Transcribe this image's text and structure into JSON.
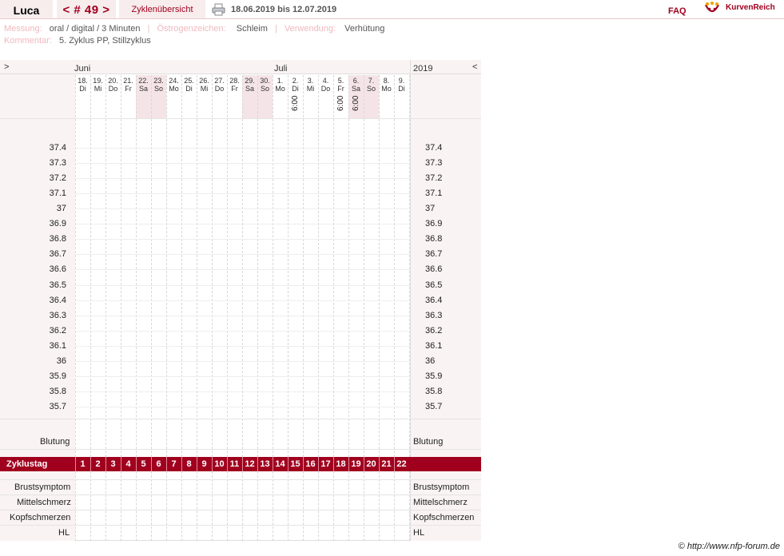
{
  "header": {
    "user_name": "Luca",
    "cycle_label": "< # 49 >",
    "overview_label": "Zyklenübersicht",
    "date_range": "18.06.2019 bis 12.07.2019",
    "faq": "FAQ",
    "logo_text": "KurvenReich"
  },
  "meta": {
    "messung_label": "Messung:",
    "messung_value": "oral / digital / 3 Minuten",
    "oestrogen_label": "Östrogenzeichen:",
    "oestrogen_value": "Schleim",
    "verwendung_label": "Verwendung:",
    "verwendung_value": "Verhütung",
    "kommentar_label": "Kommentar:",
    "kommentar_value": "5. Zyklus PP, Stillzyklus"
  },
  "nav": {
    "prev": ">",
    "next": "<",
    "month1": "Juni",
    "month2": "Juli",
    "year": "2019"
  },
  "days": [
    {
      "d": "18.",
      "w": "Di"
    },
    {
      "d": "19.",
      "w": "Mi"
    },
    {
      "d": "20.",
      "w": "Do"
    },
    {
      "d": "21.",
      "w": "Fr"
    },
    {
      "d": "22.",
      "w": "Sa"
    },
    {
      "d": "23.",
      "w": "So"
    },
    {
      "d": "24.",
      "w": "Mo"
    },
    {
      "d": "25.",
      "w": "Di"
    },
    {
      "d": "26.",
      "w": "Mi"
    },
    {
      "d": "27.",
      "w": "Do"
    },
    {
      "d": "28.",
      "w": "Fr"
    },
    {
      "d": "29.",
      "w": "Sa"
    },
    {
      "d": "30.",
      "w": "So"
    },
    {
      "d": "1.",
      "w": "Mo"
    },
    {
      "d": "2.",
      "w": "Di"
    },
    {
      "d": "3.",
      "w": "Mi"
    },
    {
      "d": "4.",
      "w": "Do"
    },
    {
      "d": "5.",
      "w": "Fr"
    },
    {
      "d": "6.",
      "w": "Sa"
    },
    {
      "d": "7.",
      "w": "So"
    },
    {
      "d": "8.",
      "w": "Mo"
    },
    {
      "d": "9.",
      "w": "Di"
    }
  ],
  "weekend_indices": [
    4,
    5,
    11,
    12,
    18,
    19
  ],
  "times": [
    {
      "index": 14,
      "time": "6:00"
    },
    {
      "index": 17,
      "time": "6:00"
    },
    {
      "index": 18,
      "time": "6:00"
    }
  ],
  "temperatures": [
    "37.4",
    "37.3",
    "37.2",
    "37.1",
    "37",
    "36.9",
    "36.8",
    "36.7",
    "36.6",
    "36.5",
    "36.4",
    "36.3",
    "36.2",
    "36.1",
    "36",
    "35.9",
    "35.8",
    "35.7"
  ],
  "rows": {
    "blutung": "Blutung",
    "zyklustag": "Zyklustag",
    "brustsymptom": "Brustsymptom",
    "mittelschmerz": "Mittelschmerz",
    "kopfschmerzen": "Kopfschmerzen",
    "hl": "HL"
  },
  "cycle_days": [
    "1",
    "2",
    "3",
    "4",
    "5",
    "6",
    "7",
    "8",
    "9",
    "10",
    "11",
    "12",
    "13",
    "14",
    "15",
    "16",
    "17",
    "18",
    "19",
    "20",
    "21",
    "22"
  ],
  "copyright": "© http://www.nfp-forum.de",
  "colors": {
    "accent": "#a0001e",
    "panel": "#faf3f3",
    "weekend": "#f5e4e7"
  }
}
